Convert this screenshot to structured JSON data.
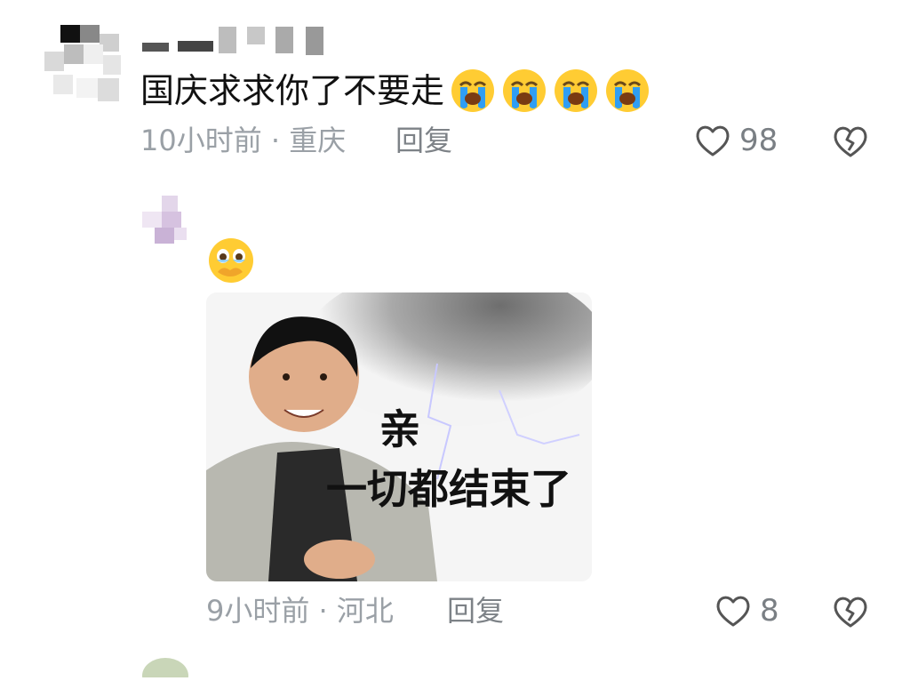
{
  "comments": [
    {
      "text": "国庆求求你了不要走",
      "emoji_name": "loudly-crying-face",
      "emoji_count": 4,
      "time": "10小时前",
      "separator": "·",
      "location": "重庆",
      "reply_label": "回复",
      "likes": "98"
    },
    {
      "emoji_name": "face-holding-back-tears",
      "meme_caption_line1": "亲",
      "meme_caption_line2": "一切都结束了",
      "time": "9小时前",
      "separator": "·",
      "location": "河北",
      "reply_label": "回复",
      "likes": "8"
    }
  ],
  "icons": {
    "like": "heart-outline-icon",
    "dislike": "broken-heart-icon"
  },
  "colors": {
    "meta_gray": "#9aa0a6",
    "emoji_yellow": "#ffcc33",
    "tear_blue": "#2f9ef3"
  }
}
